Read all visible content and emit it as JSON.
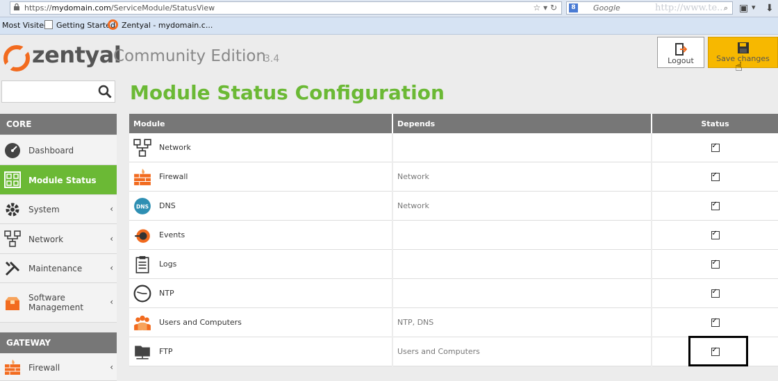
{
  "browser": {
    "url_scheme": "https://",
    "url_host": "mydomain.com",
    "url_path": "/ServiceModule/StatusView",
    "search_placeholder": "Google",
    "watermark": "http://www.te..."
  },
  "bookmarks": [
    "Most Visited",
    "Getting Started",
    "Zentyal - mydomain.c..."
  ],
  "app": {
    "brand": "zentyal",
    "edition": "Community Edition",
    "version": "3.4",
    "brand_color": "#f26b1f",
    "accent_color": "#6bb935"
  },
  "buttons": {
    "logout": "Logout",
    "save": "Save changes"
  },
  "sidebar": {
    "search_value": "",
    "core_header": "CORE",
    "gateway_header": "GATEWAY",
    "items": [
      {
        "label": "Dashboard",
        "icon": "dashboard-icon",
        "active": false,
        "submenu": false
      },
      {
        "label": "Module Status",
        "icon": "module-status-icon",
        "active": true,
        "submenu": false
      },
      {
        "label": "System",
        "icon": "gear-icon",
        "active": false,
        "submenu": true
      },
      {
        "label": "Network",
        "icon": "network-icon",
        "active": false,
        "submenu": true
      },
      {
        "label": "Maintenance",
        "icon": "tools-icon",
        "active": false,
        "submenu": true
      },
      {
        "label": "Software Management",
        "icon": "package-icon",
        "active": false,
        "submenu": true
      }
    ],
    "gateway_items": [
      {
        "label": "Firewall",
        "icon": "firewall-icon",
        "submenu": true
      }
    ]
  },
  "main": {
    "title": "Module Status Configuration",
    "columns": [
      "Module",
      "Depends",
      "Status"
    ],
    "rows": [
      {
        "module": "Network",
        "depends": "",
        "enabled": true,
        "icon": "network-icon"
      },
      {
        "module": "Firewall",
        "depends": "Network",
        "enabled": true,
        "icon": "firewall-icon"
      },
      {
        "module": "DNS",
        "depends": "Network",
        "enabled": true,
        "icon": "dns-icon"
      },
      {
        "module": "Events",
        "depends": "",
        "enabled": true,
        "icon": "events-icon"
      },
      {
        "module": "Logs",
        "depends": "",
        "enabled": true,
        "icon": "logs-icon"
      },
      {
        "module": "NTP",
        "depends": "",
        "enabled": true,
        "icon": "clock-icon"
      },
      {
        "module": "Users and Computers",
        "depends": "NTP, DNS",
        "enabled": true,
        "icon": "users-icon"
      },
      {
        "module": "FTP",
        "depends": "Users and Computers",
        "enabled": true,
        "icon": "ftp-icon"
      }
    ]
  }
}
